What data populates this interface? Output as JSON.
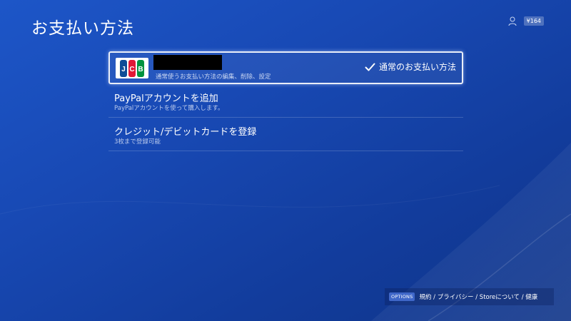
{
  "header": {
    "title": "お支払い方法",
    "wallet": "¥164",
    "user_icon": "user-silhouette-icon"
  },
  "payment_methods": {
    "card": {
      "brand": "JCB",
      "name": "",
      "sub": "通常使うお支払い方法の編集、削除、設定",
      "default_label": "通常のお支払い方法",
      "default_icon": "check-icon"
    },
    "items": [
      {
        "title": "PayPalアカウントを追加",
        "sub": "PayPalアカウントを使って購入します。"
      },
      {
        "title": "クレジット/デビットカードを登録",
        "sub": "3枚まで登録可能"
      }
    ]
  },
  "footer": {
    "options_label": "OPTIONS",
    "links_text": "規約 / プライバシー / Storeについて / 健康"
  },
  "colors": {
    "background": "#1849b4",
    "jcb_blue": "#0e4c96",
    "jcb_red": "#e21836",
    "jcb_green": "#00923f"
  }
}
